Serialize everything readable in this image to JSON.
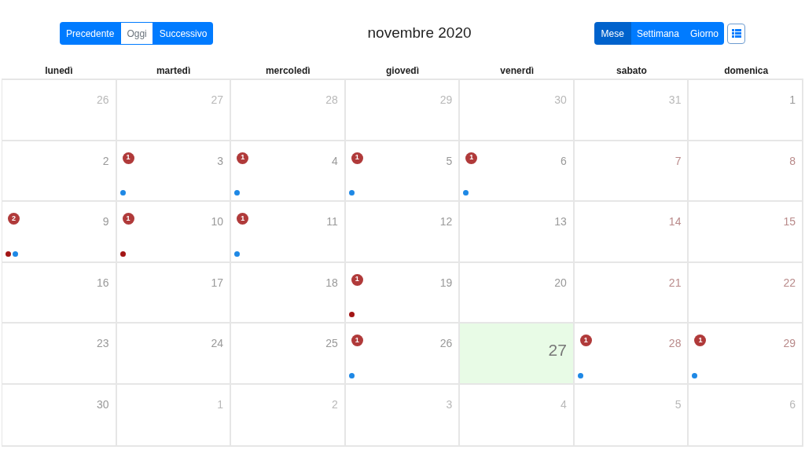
{
  "toolbar": {
    "nav_buttons": [
      {
        "label": "Precedente",
        "selected": false
      },
      {
        "label": "Oggi",
        "selected": true
      },
      {
        "label": "Successivo",
        "selected": false
      }
    ],
    "title": "novembre 2020",
    "view_buttons": [
      {
        "label": "Mese",
        "selected": true
      },
      {
        "label": "Settimana",
        "selected": false
      },
      {
        "label": "Giorno",
        "selected": false
      }
    ]
  },
  "weekdays": [
    "lunedì",
    "martedì",
    "mercoledì",
    "giovedì",
    "venerdì",
    "sabato",
    "domenica"
  ],
  "weeks": [
    [
      {
        "day": "26",
        "other_month": true,
        "today": false
      },
      {
        "day": "27",
        "other_month": true,
        "today": false
      },
      {
        "day": "28",
        "other_month": true,
        "today": false
      },
      {
        "day": "29",
        "other_month": true,
        "today": false
      },
      {
        "day": "30",
        "other_month": true,
        "today": false
      },
      {
        "day": "31",
        "other_month": true,
        "today": false
      },
      {
        "day": "1",
        "other_month": false,
        "weekend": false,
        "today": false
      }
    ],
    [
      {
        "day": "2",
        "other_month": false,
        "weekend": false,
        "today": false
      },
      {
        "day": "3",
        "other_month": false,
        "weekend": false,
        "today": false,
        "badge": "1",
        "dots": [
          {
            "color": "#1e88e5"
          }
        ]
      },
      {
        "day": "4",
        "other_month": false,
        "weekend": false,
        "today": false,
        "badge": "1",
        "dots": [
          {
            "color": "#1e88e5"
          }
        ]
      },
      {
        "day": "5",
        "other_month": false,
        "weekend": false,
        "today": false,
        "badge": "1",
        "dots": [
          {
            "color": "#1e88e5"
          }
        ]
      },
      {
        "day": "6",
        "other_month": false,
        "weekend": false,
        "today": false,
        "badge": "1",
        "dots": [
          {
            "color": "#1e88e5"
          }
        ]
      },
      {
        "day": "7",
        "other_month": false,
        "weekend": true,
        "today": false
      },
      {
        "day": "8",
        "other_month": false,
        "weekend": true,
        "today": false
      }
    ],
    [
      {
        "day": "9",
        "other_month": false,
        "weekend": false,
        "today": false,
        "badge": "2",
        "dots": [
          {
            "color": "#a31515"
          },
          {
            "color": "#1e88e5"
          }
        ]
      },
      {
        "day": "10",
        "other_month": false,
        "weekend": false,
        "today": false,
        "badge": "1",
        "dots": [
          {
            "color": "#a31515"
          }
        ]
      },
      {
        "day": "11",
        "other_month": false,
        "weekend": false,
        "today": false,
        "badge": "1",
        "dots": [
          {
            "color": "#1e88e5"
          }
        ]
      },
      {
        "day": "12",
        "other_month": false,
        "weekend": false,
        "today": false
      },
      {
        "day": "13",
        "other_month": false,
        "weekend": false,
        "today": false
      },
      {
        "day": "14",
        "other_month": false,
        "weekend": true,
        "today": false
      },
      {
        "day": "15",
        "other_month": false,
        "weekend": true,
        "today": false
      }
    ],
    [
      {
        "day": "16",
        "other_month": false,
        "weekend": false,
        "today": false
      },
      {
        "day": "17",
        "other_month": false,
        "weekend": false,
        "today": false
      },
      {
        "day": "18",
        "other_month": false,
        "weekend": false,
        "today": false
      },
      {
        "day": "19",
        "other_month": false,
        "weekend": false,
        "today": false,
        "badge": "1",
        "dots": [
          {
            "color": "#a31515"
          }
        ]
      },
      {
        "day": "20",
        "other_month": false,
        "weekend": false,
        "today": false
      },
      {
        "day": "21",
        "other_month": false,
        "weekend": true,
        "today": false
      },
      {
        "day": "22",
        "other_month": false,
        "weekend": true,
        "today": false
      }
    ],
    [
      {
        "day": "23",
        "other_month": false,
        "weekend": false,
        "today": false
      },
      {
        "day": "24",
        "other_month": false,
        "weekend": false,
        "today": false
      },
      {
        "day": "25",
        "other_month": false,
        "weekend": false,
        "today": false
      },
      {
        "day": "26",
        "other_month": false,
        "weekend": false,
        "today": false,
        "badge": "1",
        "dots": [
          {
            "color": "#1e88e5"
          }
        ]
      },
      {
        "day": "27",
        "other_month": false,
        "weekend": false,
        "today": true
      },
      {
        "day": "28",
        "other_month": false,
        "weekend": true,
        "today": false,
        "badge": "1",
        "dots": [
          {
            "color": "#1e88e5"
          }
        ]
      },
      {
        "day": "29",
        "other_month": false,
        "weekend": true,
        "today": false,
        "badge": "1",
        "dots": [
          {
            "color": "#1e88e5"
          }
        ]
      }
    ],
    [
      {
        "day": "30",
        "other_month": false,
        "weekend": false,
        "today": false
      },
      {
        "day": "1",
        "other_month": true,
        "today": false
      },
      {
        "day": "2",
        "other_month": true,
        "today": false
      },
      {
        "day": "3",
        "other_month": true,
        "today": false
      },
      {
        "day": "4",
        "other_month": true,
        "today": false
      },
      {
        "day": "5",
        "other_month": true,
        "today": false
      },
      {
        "day": "6",
        "other_month": true,
        "today": false
      }
    ]
  ]
}
